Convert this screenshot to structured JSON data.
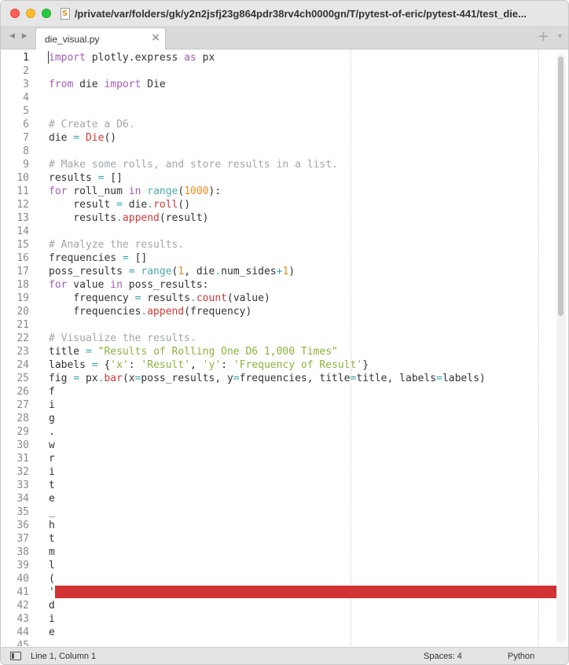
{
  "window": {
    "title": "/private/var/folders/gk/y2n2jsfj23g864pdr38rv4ch0000gn/T/pytest-of-eric/pytest-441/test_die..."
  },
  "tabbar": {
    "tab_label": "die_visual.py",
    "close_glyph": "×",
    "add_glyph": "+",
    "menu_glyph": "▾",
    "nav_glyph": "◀ ▶"
  },
  "editor": {
    "active_line": 1,
    "line_numbers": [
      "1",
      "2",
      "3",
      "4",
      "5",
      "6",
      "7",
      "8",
      "9",
      "10",
      "11",
      "12",
      "13",
      "14",
      "15",
      "16",
      "17",
      "18",
      "19",
      "20",
      "21",
      "22",
      "23",
      "24",
      "25",
      "26",
      "27",
      "28",
      "29",
      "30",
      "31",
      "32",
      "33",
      "34",
      "35",
      "36",
      "37",
      "38",
      "39",
      "40",
      "41",
      "42",
      "43",
      "44",
      "45"
    ],
    "lines": [
      "import plotly.express as px",
      "",
      "from die import Die",
      "",
      "",
      "# Create a D6.",
      "die = Die()",
      "",
      "# Make some rolls, and store results in a list.",
      "results = []",
      "for roll_num in range(1000):",
      "    result = die.roll()",
      "    results.append(result)",
      "",
      "# Analyze the results.",
      "frequencies = []",
      "poss_results = range(1, die.num_sides+1)",
      "for value in poss_results:",
      "    frequency = results.count(value)",
      "    frequencies.append(frequency)",
      "",
      "# Visualize the results.",
      "title = \"Results of Rolling One D6 1,000 Times\"",
      "labels = {'x': 'Result', 'y': 'Frequency of Result'}",
      "fig = px.bar(x=poss_results, y=frequencies, title=title, labels=labels)",
      "f",
      "i",
      "g",
      ".",
      "w",
      "r",
      "i",
      "t",
      "e",
      "_",
      "h",
      "t",
      "m",
      "l",
      "(",
      "'",
      "d",
      "i",
      "e",
      ""
    ]
  },
  "statusbar": {
    "position": "Line 1, Column 1",
    "spaces": "Spaces: 4",
    "syntax": "Python"
  },
  "colors": {
    "keyword": "#a15cb3",
    "comment": "#a0a6ab",
    "operator": "#3aa4a4",
    "number": "#f08c1e",
    "function": "#cf3a37",
    "builtin": "#4ea9ad",
    "string": "#8cb33e",
    "error_highlight": "#d13232"
  },
  "icons": {
    "file_icon": "python-file-icon",
    "sidebar_toggle": "sidebar-toggle-icon"
  }
}
